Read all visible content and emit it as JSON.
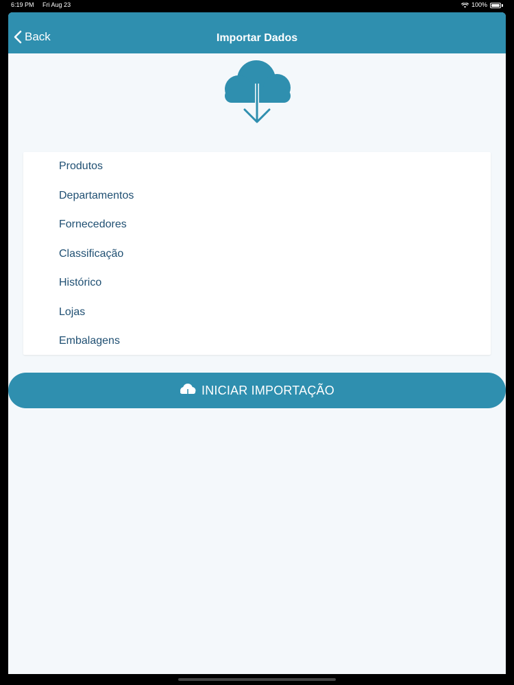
{
  "status_bar": {
    "time": "6:19 PM",
    "date": "Fri Aug 23",
    "battery": "100%"
  },
  "nav": {
    "back_label": "Back",
    "title": "Importar Dados"
  },
  "list": {
    "items": [
      {
        "label": "Produtos"
      },
      {
        "label": "Departamentos"
      },
      {
        "label": "Fornecedores"
      },
      {
        "label": "Classificação"
      },
      {
        "label": "Histórico"
      },
      {
        "label": "Lojas"
      },
      {
        "label": "Embalagens"
      }
    ]
  },
  "actions": {
    "import_label": "INICIAR IMPORTAÇÃO"
  },
  "icons": {
    "hero": "cloud-download-icon",
    "button": "cloud-download-icon",
    "back": "chevron-left-icon"
  },
  "colors": {
    "accent": "#2f8faf",
    "text": "#1f4f72",
    "background": "#f4f8fb"
  }
}
